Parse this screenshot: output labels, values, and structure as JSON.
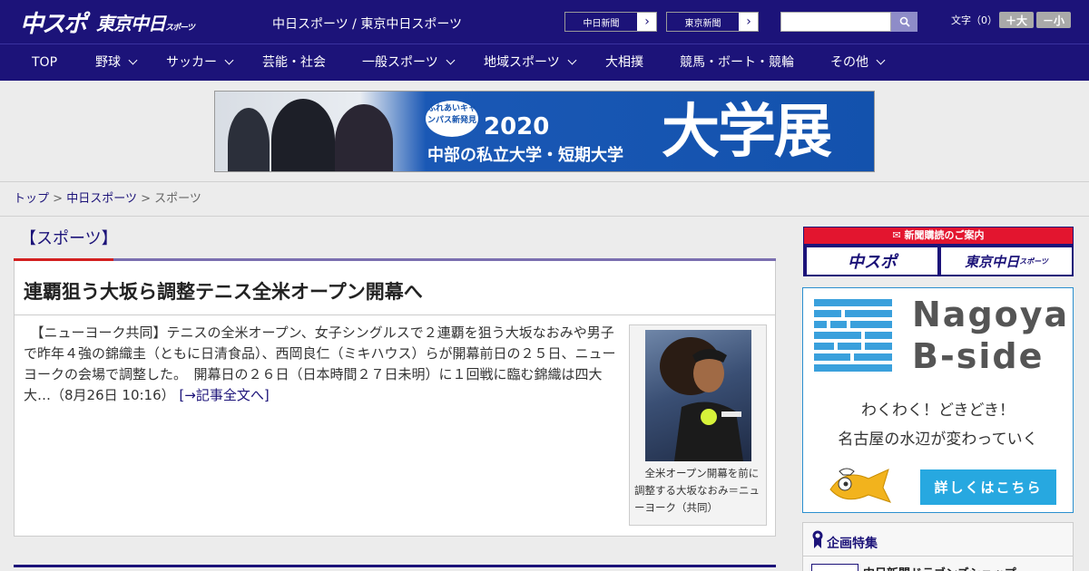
{
  "header": {
    "logo_main": "中スポ",
    "logo_sub": "東京中日",
    "logo_sub_small": "スポーツ",
    "site_names": "中日スポーツ / 東京中日スポーツ",
    "paper_links": [
      "中日新聞",
      "東京新聞"
    ],
    "font_size_label": "文字（0）",
    "font_larger": "＋大",
    "font_smaller": "－小"
  },
  "nav": {
    "items": [
      {
        "label": "TOP",
        "dropdown": false
      },
      {
        "label": "野球",
        "dropdown": true
      },
      {
        "label": "サッカー",
        "dropdown": true
      },
      {
        "label": "芸能・社会",
        "dropdown": false
      },
      {
        "label": "一般スポーツ",
        "dropdown": true
      },
      {
        "label": "地域スポーツ",
        "dropdown": true
      },
      {
        "label": "大相撲",
        "dropdown": false
      },
      {
        "label": "競馬・ボート・競輪",
        "dropdown": false
      },
      {
        "label": "その他",
        "dropdown": true
      }
    ]
  },
  "banner": {
    "badge": "ふれあいキャンパス新発見",
    "year": "2020",
    "subtitle": "中部の私立大学・短期大学",
    "headline": "大学展"
  },
  "breadcrumb": {
    "home": "トップ",
    "section": "中日スポーツ",
    "current": "スポーツ",
    "separator": ">"
  },
  "main": {
    "section_title": "【スポーツ】",
    "article": {
      "title": "連覇狙う大坂ら調整テニス全米オープン開幕へ",
      "body": "　【ニューヨーク共同】テニスの全米オープン、女子シングルスで２連覇を狙う大坂なおみや男子で昨年４強の錦織圭（ともに日清食品）、西岡良仁（ミキハウス）らが開幕前日の２５日、ニューヨークの会場で調整した。　開幕日の２６日（日本時間２７日未明）に１回戦に臨む錦織は四大大…（8月26日 10:16）",
      "more_link": "[→記事全文へ]",
      "photo_caption": "　全米オープン開幕を前に調整する大坂なおみ＝ニューヨーク（共同）"
    }
  },
  "sidebar": {
    "subscribe_head": "新聞購読のご案内",
    "subscribe_logos": [
      "中スポ",
      "東京中日"
    ],
    "subscribe_logo_small": "スポーツ",
    "ad": {
      "title_line1": "Nagoya",
      "title_line2": "B-side",
      "line1": "わくわく！どきどき！",
      "line2": "名古屋の水辺が変わっていく",
      "cta": "詳しくはこちら"
    },
    "feature_title": "企画特集",
    "feature_item": "中日新聞ドラゴンズショップ"
  },
  "colors": {
    "brand_navy": "#1c1379",
    "accent_red": "#d32020",
    "ad_blue": "#27a8e0"
  }
}
